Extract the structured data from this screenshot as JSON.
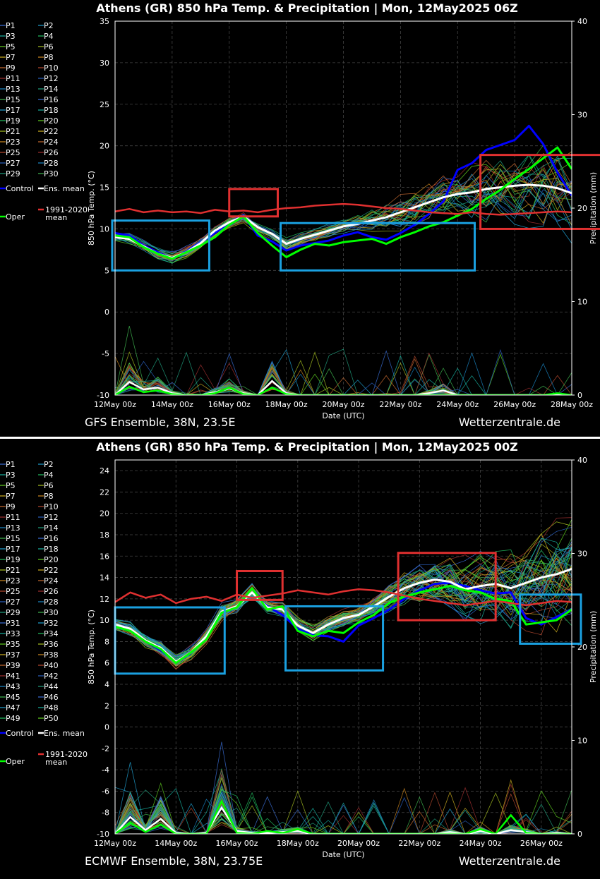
{
  "panels": [
    {
      "id": "gfs",
      "title": "Athens  (GR)  850 hPa Temp. & Precipitation | Mon, 12May2025 06Z",
      "footer_left": "GFS Ensemble, 38N, 23.5E",
      "footer_right": "Wetterzentrale.de",
      "legend": [
        "P1",
        "P2",
        "P3",
        "P4",
        "P5",
        "P6",
        "P7",
        "P8",
        "P9",
        "P10",
        "P11",
        "P12",
        "P13",
        "P14",
        "P15",
        "P16",
        "P17",
        "P18",
        "P19",
        "P20",
        "P21",
        "P22",
        "P23",
        "P24",
        "P25",
        "P26",
        "P27",
        "P28",
        "P29",
        "P30"
      ],
      "legend_special": [
        "Control",
        "Ens. mean",
        "Oper",
        "1991-2020 mean"
      ],
      "chart_data": {
        "type": "line",
        "ylabel": "850 hPa Temp. (°C)",
        "y2label": "Precipitation (mm)",
        "xlabel": "Date (UTC)",
        "ylim": [
          -10,
          35
        ],
        "y2lim": [
          0,
          40
        ],
        "yticks": [
          -10,
          -5,
          0,
          5,
          10,
          15,
          20,
          25,
          30,
          35
        ],
        "y2ticks": [
          0,
          10,
          20,
          30,
          40
        ],
        "xlim_days": [
          0,
          16
        ],
        "xticks": [
          "12May 00z",
          "14May 00z",
          "16May 00z",
          "18May 00z",
          "20May 00z",
          "22May 00z",
          "24May 00z",
          "26May 00z",
          "28May 00z"
        ],
        "x": [
          0,
          0.5,
          1,
          1.5,
          2,
          2.5,
          3,
          3.5,
          4,
          4.5,
          5,
          5.5,
          6,
          6.5,
          7,
          7.5,
          8,
          8.5,
          9,
          9.5,
          10,
          10.5,
          11,
          11.5,
          12,
          12.5,
          13,
          13.5,
          14,
          14.5,
          15,
          15.5,
          16
        ],
        "series": [
          {
            "name": "Control",
            "color": "#0000ff",
            "width": 3,
            "values": [
              9.5,
              9.2,
              8.0,
              7.2,
              6.4,
              7.3,
              8.4,
              9.5,
              10.8,
              11.6,
              9.2,
              8.5,
              7.4,
              8.0,
              8.3,
              8.6,
              9.2,
              9.6,
              9.0,
              8.7,
              9.5,
              10.5,
              11.8,
              13.3,
              17.1,
              17.9,
              19.5,
              20.1,
              20.7,
              22.4,
              20.2,
              16.8,
              14.0
            ]
          },
          {
            "name": "Ens. mean",
            "color": "#ffffff",
            "width": 3,
            "values": [
              9.0,
              8.8,
              7.9,
              7.0,
              6.5,
              7.2,
              8.3,
              9.8,
              10.8,
              11.5,
              10.2,
              9.4,
              8.2,
              8.8,
              9.3,
              9.8,
              10.3,
              10.6,
              11.0,
              11.4,
              12.0,
              12.6,
              13.2,
              13.8,
              14.2,
              14.4,
              14.8,
              15.0,
              15.2,
              15.3,
              15.2,
              14.9,
              14.3
            ]
          },
          {
            "name": "Oper",
            "color": "#00ff00",
            "width": 3,
            "values": [
              9.2,
              9.0,
              7.8,
              7.0,
              6.4,
              7.2,
              8.0,
              9.0,
              10.5,
              11.5,
              9.5,
              8.0,
              6.6,
              7.5,
              8.2,
              8.0,
              8.4,
              8.6,
              8.8,
              8.2,
              9.0,
              9.6,
              10.3,
              10.8,
              11.6,
              12.4,
              13.6,
              14.7,
              16.0,
              17.2,
              18.5,
              19.8,
              17.2
            ]
          },
          {
            "name": "1991-2020 mean",
            "color": "#e03030",
            "width": 2.5,
            "values": [
              12.1,
              12.4,
              12.0,
              12.2,
              12.0,
              12.1,
              11.9,
              12.3,
              12.1,
              12.2,
              12.0,
              12.3,
              12.5,
              12.6,
              12.8,
              12.9,
              13.0,
              12.9,
              12.7,
              12.5,
              12.4,
              12.2,
              12.0,
              11.9,
              11.8,
              12.0,
              11.8,
              11.7,
              11.8,
              11.9,
              12.0,
              12.1,
              12.0
            ]
          }
        ],
        "precip_series": [
          {
            "name": "Ens. mean",
            "color": "#ffffff",
            "values": [
              0,
              1.4,
              0.6,
              0.8,
              0.2,
              0,
              0,
              0.3,
              0.7,
              0.2,
              0,
              1.5,
              0.2,
              0,
              0,
              0,
              0,
              0,
              0,
              0,
              0,
              0,
              0.2,
              0.5,
              0,
              0,
              0,
              0,
              0,
              0,
              0,
              0,
              0
            ]
          },
          {
            "name": "Oper",
            "color": "#00ff00",
            "values": [
              0,
              0.9,
              0.3,
              0.5,
              0.1,
              0,
              0,
              0.2,
              0.8,
              0.1,
              0,
              0.8,
              0.1,
              0,
              0,
              0,
              0,
              0,
              0,
              0,
              0,
              0,
              0,
              0,
              0,
              0,
              0,
              0,
              0,
              0,
              0,
              0.2,
              0
            ]
          }
        ],
        "boxes": [
          {
            "color": "#1aa0e0",
            "x": [
              -0.1,
              3.3
            ],
            "y": [
              5,
              11
            ]
          },
          {
            "color": "#e03030",
            "x": [
              4.0,
              5.7
            ],
            "y": [
              11.5,
              14.8
            ]
          },
          {
            "color": "#1aa0e0",
            "x": [
              5.8,
              12.6
            ],
            "y": [
              5,
              10.7
            ]
          },
          {
            "color": "#e03030",
            "x": [
              12.8,
              19.5
            ],
            "y": [
              10,
              18.9
            ]
          }
        ]
      }
    },
    {
      "id": "ec",
      "title": "Athens  (GR)  850 hPa Temp. & Precipitation | Mon, 12May2025 00Z",
      "footer_left": "ECMWF Ensemble, 38N, 23.75E",
      "footer_right": "Wetterzentrale.de",
      "legend": [
        "P1",
        "P2",
        "P3",
        "P4",
        "P5",
        "P6",
        "P7",
        "P8",
        "P9",
        "P10",
        "P11",
        "P12",
        "P13",
        "P14",
        "P15",
        "P16",
        "P17",
        "P18",
        "P19",
        "P20",
        "P21",
        "P22",
        "P23",
        "P24",
        "P25",
        "P26",
        "P27",
        "P28",
        "P29",
        "P30",
        "P31",
        "P32",
        "P33",
        "P34",
        "P35",
        "P36",
        "P37",
        "P38",
        "P39",
        "P40",
        "P41",
        "P42",
        "P43",
        "P44",
        "P45",
        "P46",
        "P47",
        "P48",
        "P49",
        "P50"
      ],
      "legend_special": [
        "Control",
        "Ens. mean",
        "Oper",
        "1991-2020 mean"
      ],
      "chart_data": {
        "type": "line",
        "ylabel": "850 hPa Temp. (°C)",
        "y2label": "Precipitation (mm)",
        "xlabel": "Date (UTC)",
        "ylim": [
          -10,
          25
        ],
        "y2lim": [
          0,
          40
        ],
        "yticks": [
          -10,
          -8,
          -6,
          -4,
          -2,
          0,
          2,
          4,
          6,
          8,
          10,
          12,
          14,
          16,
          18,
          20,
          22,
          24
        ],
        "y2ticks": [
          0,
          10,
          20,
          30,
          40
        ],
        "xlim_days": [
          0,
          15
        ],
        "xticks": [
          "12May 00z",
          "14May 00z",
          "16May 00z",
          "18May 00z",
          "20May 00z",
          "22May 00z",
          "24May 00z",
          "26May 00z"
        ],
        "x": [
          0,
          0.5,
          1,
          1.5,
          2,
          2.5,
          3,
          3.5,
          4,
          4.5,
          5,
          5.5,
          6,
          6.5,
          7,
          7.5,
          8,
          8.5,
          9,
          9.5,
          10,
          10.5,
          11,
          11.5,
          12,
          12.5,
          13,
          13.5,
          14,
          14.5,
          15
        ],
        "series": [
          {
            "name": "Control",
            "color": "#0000ff",
            "width": 3,
            "values": [
              9.4,
              9.0,
              8.0,
              7.2,
              6.1,
              7.0,
              8.3,
              10.8,
              11.3,
              12.6,
              11.3,
              10.5,
              9.2,
              8.6,
              8.5,
              8.0,
              9.5,
              10.2,
              11.0,
              12.0,
              12.8,
              13.4,
              13.5,
              13.2,
              12.8,
              12.5,
              12.6,
              10.2,
              9.6,
              10.3,
              11.0
            ]
          },
          {
            "name": "Ens. mean",
            "color": "#ffffff",
            "width": 3,
            "values": [
              9.6,
              9.2,
              8.1,
              7.4,
              6.1,
              7.0,
              8.5,
              10.8,
              11.3,
              12.6,
              11.2,
              11.0,
              9.5,
              8.8,
              9.6,
              10.2,
              10.5,
              11.3,
              12.2,
              13.0,
              13.5,
              13.8,
              13.6,
              12.9,
              13.2,
              13.4,
              13.0,
              13.5,
              14.0,
              14.3,
              14.8
            ]
          },
          {
            "name": "Oper",
            "color": "#00ff00",
            "width": 3,
            "values": [
              9.4,
              9.0,
              8.0,
              7.3,
              6.0,
              7.0,
              8.2,
              10.7,
              11.2,
              13.0,
              11.0,
              11.3,
              9.0,
              8.5,
              9.0,
              8.8,
              9.8,
              10.5,
              11.6,
              12.2,
              12.6,
              12.9,
              13.2,
              12.8,
              12.6,
              12.0,
              11.8,
              9.6,
              9.8,
              10.0,
              11.0
            ]
          },
          {
            "name": "1991-2020 mean",
            "color": "#e03030",
            "width": 2.5,
            "values": [
              11.7,
              12.6,
              12.1,
              12.4,
              11.6,
              12.0,
              12.2,
              11.8,
              12.4,
              12.1,
              12.3,
              12.5,
              12.8,
              12.6,
              12.4,
              12.7,
              12.9,
              12.8,
              12.6,
              12.3,
              12.0,
              11.8,
              11.6,
              11.4,
              11.6,
              11.8,
              11.6,
              11.4,
              11.6,
              11.8,
              11.7
            ]
          }
        ],
        "precip_series": [
          {
            "name": "Ens. mean",
            "color": "#ffffff",
            "values": [
              0,
              1.8,
              0.4,
              1.6,
              0.1,
              0,
              0.1,
              2.8,
              0.3,
              0.1,
              0.1,
              0.2,
              0.3,
              0,
              0,
              0,
              0,
              0,
              0,
              0,
              0,
              0,
              0.2,
              0,
              0.3,
              0,
              0.4,
              0.2,
              0,
              0.1,
              0
            ]
          },
          {
            "name": "Oper",
            "color": "#00ff00",
            "values": [
              0,
              1.2,
              0.2,
              1.0,
              0,
              0,
              0,
              3.5,
              0.1,
              0,
              0.3,
              0.1,
              0.5,
              0,
              0,
              0,
              0,
              0,
              0,
              0,
              0,
              0,
              0,
              0,
              0.5,
              0,
              2.0,
              0.1,
              0,
              0,
              0
            ]
          }
        ],
        "boxes": [
          {
            "color": "#1aa0e0",
            "x": [
              0.0,
              3.6
            ],
            "y": [
              5,
              11.2
            ]
          },
          {
            "color": "#e03030",
            "x": [
              4.0,
              5.5
            ],
            "y": [
              11.9,
              14.6
            ]
          },
          {
            "color": "#1aa0e0",
            "x": [
              5.6,
              8.8
            ],
            "y": [
              5.3,
              11.3
            ]
          },
          {
            "color": "#e03030",
            "x": [
              9.3,
              12.5
            ],
            "y": [
              10.0,
              16.3
            ]
          },
          {
            "color": "#1aa0e0",
            "x": [
              13.3,
              15.3
            ],
            "y": [
              7.8,
              12.4
            ]
          }
        ]
      }
    }
  ]
}
